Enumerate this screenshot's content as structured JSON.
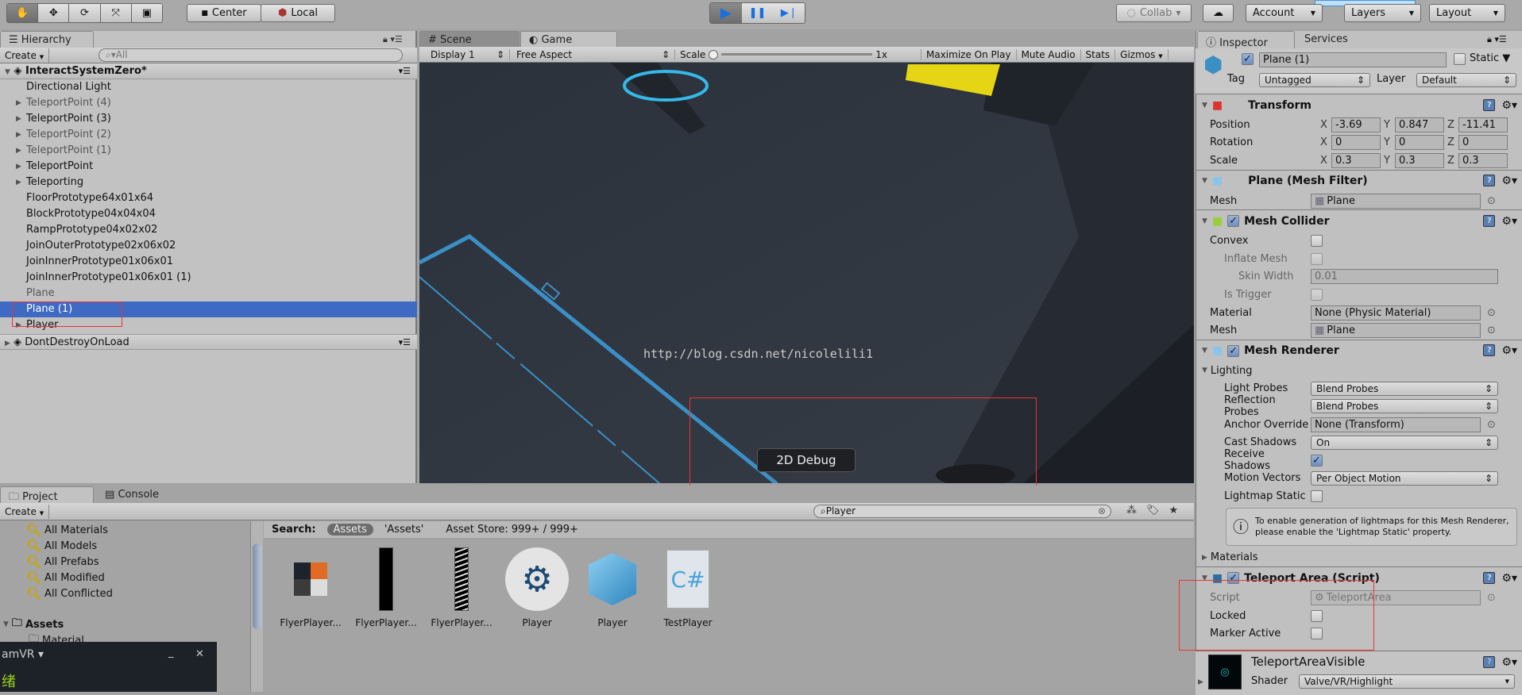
{
  "toolbar": {
    "tools": [
      "hand-tool",
      "move-tool",
      "rotate-tool",
      "scale-tool",
      "rect-tool"
    ],
    "pivot_center": "Center",
    "pivot_local": "Local",
    "collab": "Collab",
    "account": "Account",
    "layers": "Layers",
    "layout": "Layout"
  },
  "hierarchy": {
    "tab": "Hierarchy",
    "create": "Create",
    "search_placeholder": "All",
    "scene": "InteractSystemZero*",
    "items": [
      {
        "label": "Directional Light",
        "arrow": false,
        "grey": false
      },
      {
        "label": "TeleportPoint (4)",
        "arrow": true,
        "grey": true
      },
      {
        "label": "TeleportPoint (3)",
        "arrow": true,
        "grey": false
      },
      {
        "label": "TeleportPoint (2)",
        "arrow": true,
        "grey": true
      },
      {
        "label": "TeleportPoint (1)",
        "arrow": true,
        "grey": true
      },
      {
        "label": "TeleportPoint",
        "arrow": true,
        "grey": false
      },
      {
        "label": "Teleporting",
        "arrow": true,
        "grey": false
      },
      {
        "label": "FloorPrototype64x01x64",
        "arrow": false,
        "grey": false
      },
      {
        "label": "BlockPrototype04x04x04",
        "arrow": false,
        "grey": false
      },
      {
        "label": "RampPrototype04x02x02",
        "arrow": false,
        "grey": false
      },
      {
        "label": "JoinOuterPrototype02x06x02",
        "arrow": false,
        "grey": false
      },
      {
        "label": "JoinInnerPrototype01x06x01",
        "arrow": false,
        "grey": false
      },
      {
        "label": "JoinInnerPrototype01x06x01 (1)",
        "arrow": false,
        "grey": false
      },
      {
        "label": "Plane",
        "arrow": false,
        "grey": true
      },
      {
        "label": "Plane (1)",
        "arrow": false,
        "grey": false,
        "selected": true
      },
      {
        "label": "Player",
        "arrow": true,
        "grey": false
      }
    ],
    "scene2": "DontDestroyOnLoad"
  },
  "game": {
    "tabs": [
      "Scene",
      "Game"
    ],
    "display": "Display 1",
    "aspect": "Free Aspect",
    "scale_label": "Scale",
    "scale_value": "1x",
    "maximize": "Maximize On Play",
    "mute": "Mute Audio",
    "stats": "Stats",
    "gizmos": "Gizmos",
    "watermark": "http://blog.csdn.net/nicolelili1",
    "debug_button": "2D Debug"
  },
  "project": {
    "tabs": [
      "Project",
      "Console"
    ],
    "create": "Create",
    "search_value": "Player",
    "favorites": [
      "All Materials",
      "All Models",
      "All Prefabs",
      "All Modified",
      "All Conflicted"
    ],
    "assets_root": "Assets",
    "assets_child": "Material",
    "search_label": "Search:",
    "scope_assets": "Assets",
    "scope_quoted": "'Assets'",
    "asset_store": "Asset Store: 999+ / 999+",
    "assets": [
      {
        "label": "FlyerPlayer...",
        "icon": "texture-icon"
      },
      {
        "label": "FlyerPlayer...",
        "icon": "texture-icon"
      },
      {
        "label": "FlyerPlayer...",
        "icon": "texture-icon"
      },
      {
        "label": "Player",
        "icon": "steam-icon"
      },
      {
        "label": "Player",
        "icon": "prefab-cube-icon"
      },
      {
        "label": "TestPlayer",
        "icon": "csharp-script-icon"
      }
    ]
  },
  "steamvr": {
    "title": "amVR",
    "status": "绪"
  },
  "inspector": {
    "tabs": [
      "Inspector",
      "Services"
    ],
    "name": "Plane (1)",
    "static_label": "Static",
    "tag_label": "Tag",
    "tag": "Untagged",
    "layer_label": "Layer",
    "layer": "Default",
    "transform": {
      "title": "Transform",
      "rows": [
        {
          "label": "Position",
          "x": "-3.69",
          "y": "0.847",
          "z": "-11.41"
        },
        {
          "label": "Rotation",
          "x": "0",
          "y": "0",
          "z": "0"
        },
        {
          "label": "Scale",
          "x": "0.3",
          "y": "0.3",
          "z": "0.3"
        }
      ]
    },
    "mesh_filter": {
      "title": "Plane (Mesh Filter)",
      "mesh_label": "Mesh",
      "mesh": "Plane"
    },
    "mesh_collider": {
      "title": "Mesh Collider",
      "enabled": true,
      "convex": "Convex",
      "inflate": "Inflate Mesh",
      "skin": "Skin Width",
      "skin_value": "0.01",
      "trigger": "Is Trigger",
      "material_label": "Material",
      "material": "None (Physic Material)",
      "mesh_label": "Mesh",
      "mesh": "Plane"
    },
    "mesh_renderer": {
      "title": "Mesh Renderer",
      "enabled": true,
      "lighting": "Lighting",
      "light_probes_label": "Light Probes",
      "light_probes": "Blend Probes",
      "reflection_label": "Reflection Probes",
      "reflection": "Blend Probes",
      "anchor_label": "Anchor Override",
      "anchor": "None (Transform)",
      "cast_label": "Cast Shadows",
      "cast": "On",
      "receive_label": "Receive Shadows",
      "receive": true,
      "motion_label": "Motion Vectors",
      "motion": "Per Object Motion",
      "lightmap_label": "Lightmap Static",
      "lightmap": false,
      "help": "To enable generation of lightmaps for this Mesh Renderer, please enable the 'Lightmap Static' property.",
      "materials": "Materials"
    },
    "teleport_area": {
      "title": "Teleport Area (Script)",
      "enabled": true,
      "script_label": "Script",
      "script": "TeleportArea",
      "locked_label": "Locked",
      "locked": false,
      "marker_label": "Marker Active",
      "marker": false
    },
    "material": {
      "name": "TeleportAreaVisible",
      "shader_label": "Shader",
      "shader": "Valve/VR/Highlight"
    }
  },
  "colors": {
    "selection": "#3e6ac4",
    "annotation": "#ee3333",
    "play_active": "#1a6fe0"
  }
}
